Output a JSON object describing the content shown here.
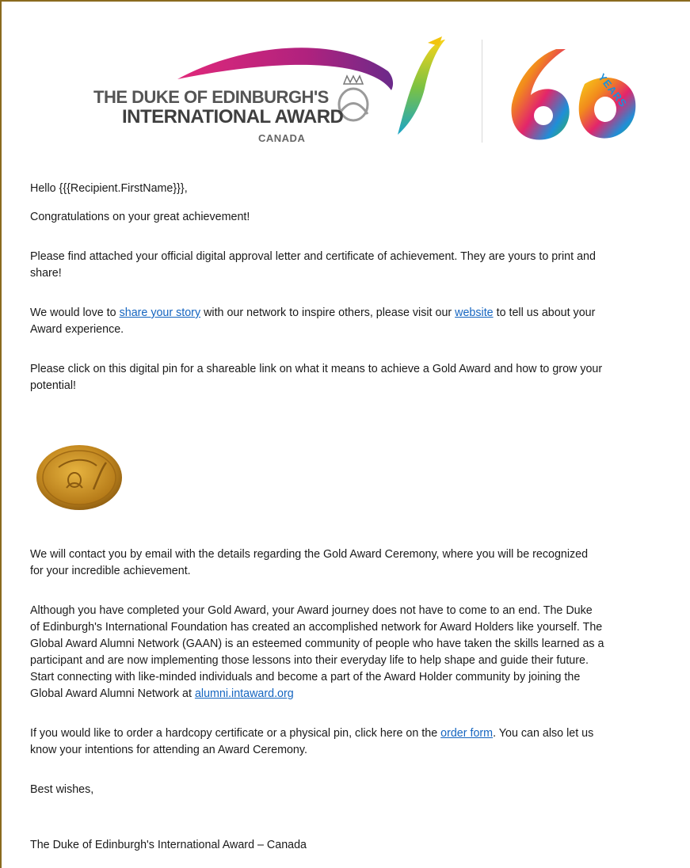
{
  "logo": {
    "line1": "THE DUKE OF EDINBURGH'S",
    "line2": "INTERNATIONAL AWARD",
    "line3": "CANADA",
    "years_text": "YEARS",
    "colors": {
      "magenta": "#b0227e",
      "yellow": "#f2c40c",
      "green": "#3cae4b",
      "gold": "#b8892a",
      "text": "#555555"
    }
  },
  "email": {
    "greeting": "Hello {{{Recipient.FirstName}}},",
    "p_congrats": "Congratulations on your great achievement!",
    "p_attached_l1": "Please find attached your official digital approval letter and certificate of achievement. They are yours to print and",
    "p_attached_l2": "share!",
    "p_story_a": "We would love to ",
    "p_story_link1": "share your story",
    "p_story_b": " with our network to inspire others, please visit our ",
    "p_story_link2": "website",
    "p_story_c": " to tell us about your",
    "p_story_l2": "Award experience.",
    "p_pin_l1": "Please click on this digital pin for a shareable link on what it means to achieve a Gold Award and how to grow your",
    "p_pin_l2": "potential!",
    "p_contact_l1": "We will contact you by email with the details regarding the Gold Award Ceremony, where you will be recognized",
    "p_contact_l2": "for your incredible achievement.",
    "p_journey_l1": "Although you have completed your Gold Award, your Award journey does not have to come to an end. The Duke",
    "p_journey_l2": "of Edinburgh's International Foundation has created an accomplished network for Award Holders like yourself. The",
    "p_journey_l3": "Global Award Alumni Network (GAAN) is an esteemed community of people who have taken the skills learned as a",
    "p_journey_l4": "participant and are now implementing those lessons into their everyday life to help shape and guide their future.",
    "p_journey_l5": "Start connecting with like-minded individuals and become a part of the Award Holder community by joining the",
    "p_journey_l6a": "Global Award Alumni Network at ",
    "p_journey_link": "alumni.intaward.org",
    "p_order_a": "If you would like to order a hardcopy certificate or a physical pin, click here on the ",
    "p_order_link": "order form",
    "p_order_b": ". You can also let us",
    "p_order_l2": "know your intentions for attending an Award Ceremony.",
    "signoff": "Best wishes,",
    "signature": "The Duke of Edinburgh's International Award – Canada"
  }
}
